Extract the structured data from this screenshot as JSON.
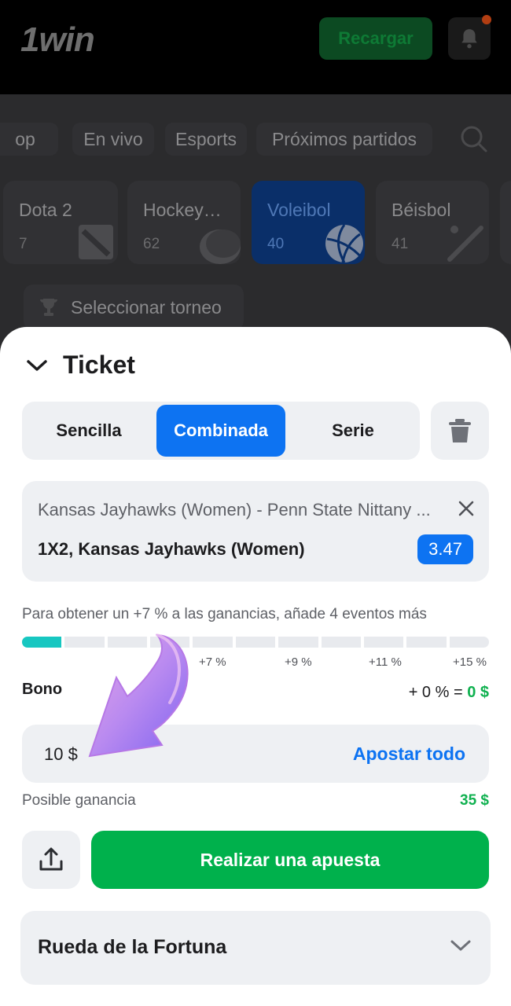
{
  "header": {
    "logo": "1win",
    "recharge_label": "Recargar",
    "icons": {
      "bell": "bell-icon",
      "search": "search-icon"
    }
  },
  "nav_tabs": [
    {
      "label": "op"
    },
    {
      "label": "En vivo"
    },
    {
      "label": "Esports"
    },
    {
      "label": "Próximos partidos"
    }
  ],
  "sports": [
    {
      "name": "Dota 2",
      "count": "7",
      "icon": "dota-icon"
    },
    {
      "name": "Hockey…",
      "count": "62",
      "icon": "hockey-puck-icon"
    },
    {
      "name": "Voleibol",
      "count": "40",
      "icon": "volleyball-icon",
      "active": true
    },
    {
      "name": "Béisbol",
      "count": "41",
      "icon": "baseball-bat-icon"
    }
  ],
  "tournament_label": "Seleccionar torneo",
  "ticket": {
    "title": "Ticket",
    "types": [
      "Sencilla",
      "Combinada",
      "Serie"
    ],
    "selected_type": "Combinada",
    "bet": {
      "match": "Kansas Jayhawks (Women) - Penn State Nittany ...",
      "selection": "1X2, Kansas Jayhawks (Women)",
      "odds": "3.47"
    },
    "bonus_hint": "Para obtener un +7 % a las ganancias, añade 4 eventos más",
    "progress": {
      "segments": 11,
      "filled": 1
    },
    "progress_labels": [
      "+7 %",
      "+9 %",
      "+11 %",
      "+15 %"
    ],
    "bono_label": "Bono",
    "bono_formula": "+ 0 % = ",
    "bono_amount": "0 $",
    "stake": "10 $",
    "bet_all_label": "Apostar todo",
    "possible_gain_label": "Posible ganancia",
    "possible_gain_value": "35 $",
    "place_bet_label": "Realizar una apuesta",
    "fortune_label": "Rueda de la Fortuna"
  },
  "colors": {
    "accent_blue": "#0d73f2",
    "green": "#00b14c",
    "progress_fill": "#17c7c1",
    "arrow_purple": "#9b6cf2"
  }
}
